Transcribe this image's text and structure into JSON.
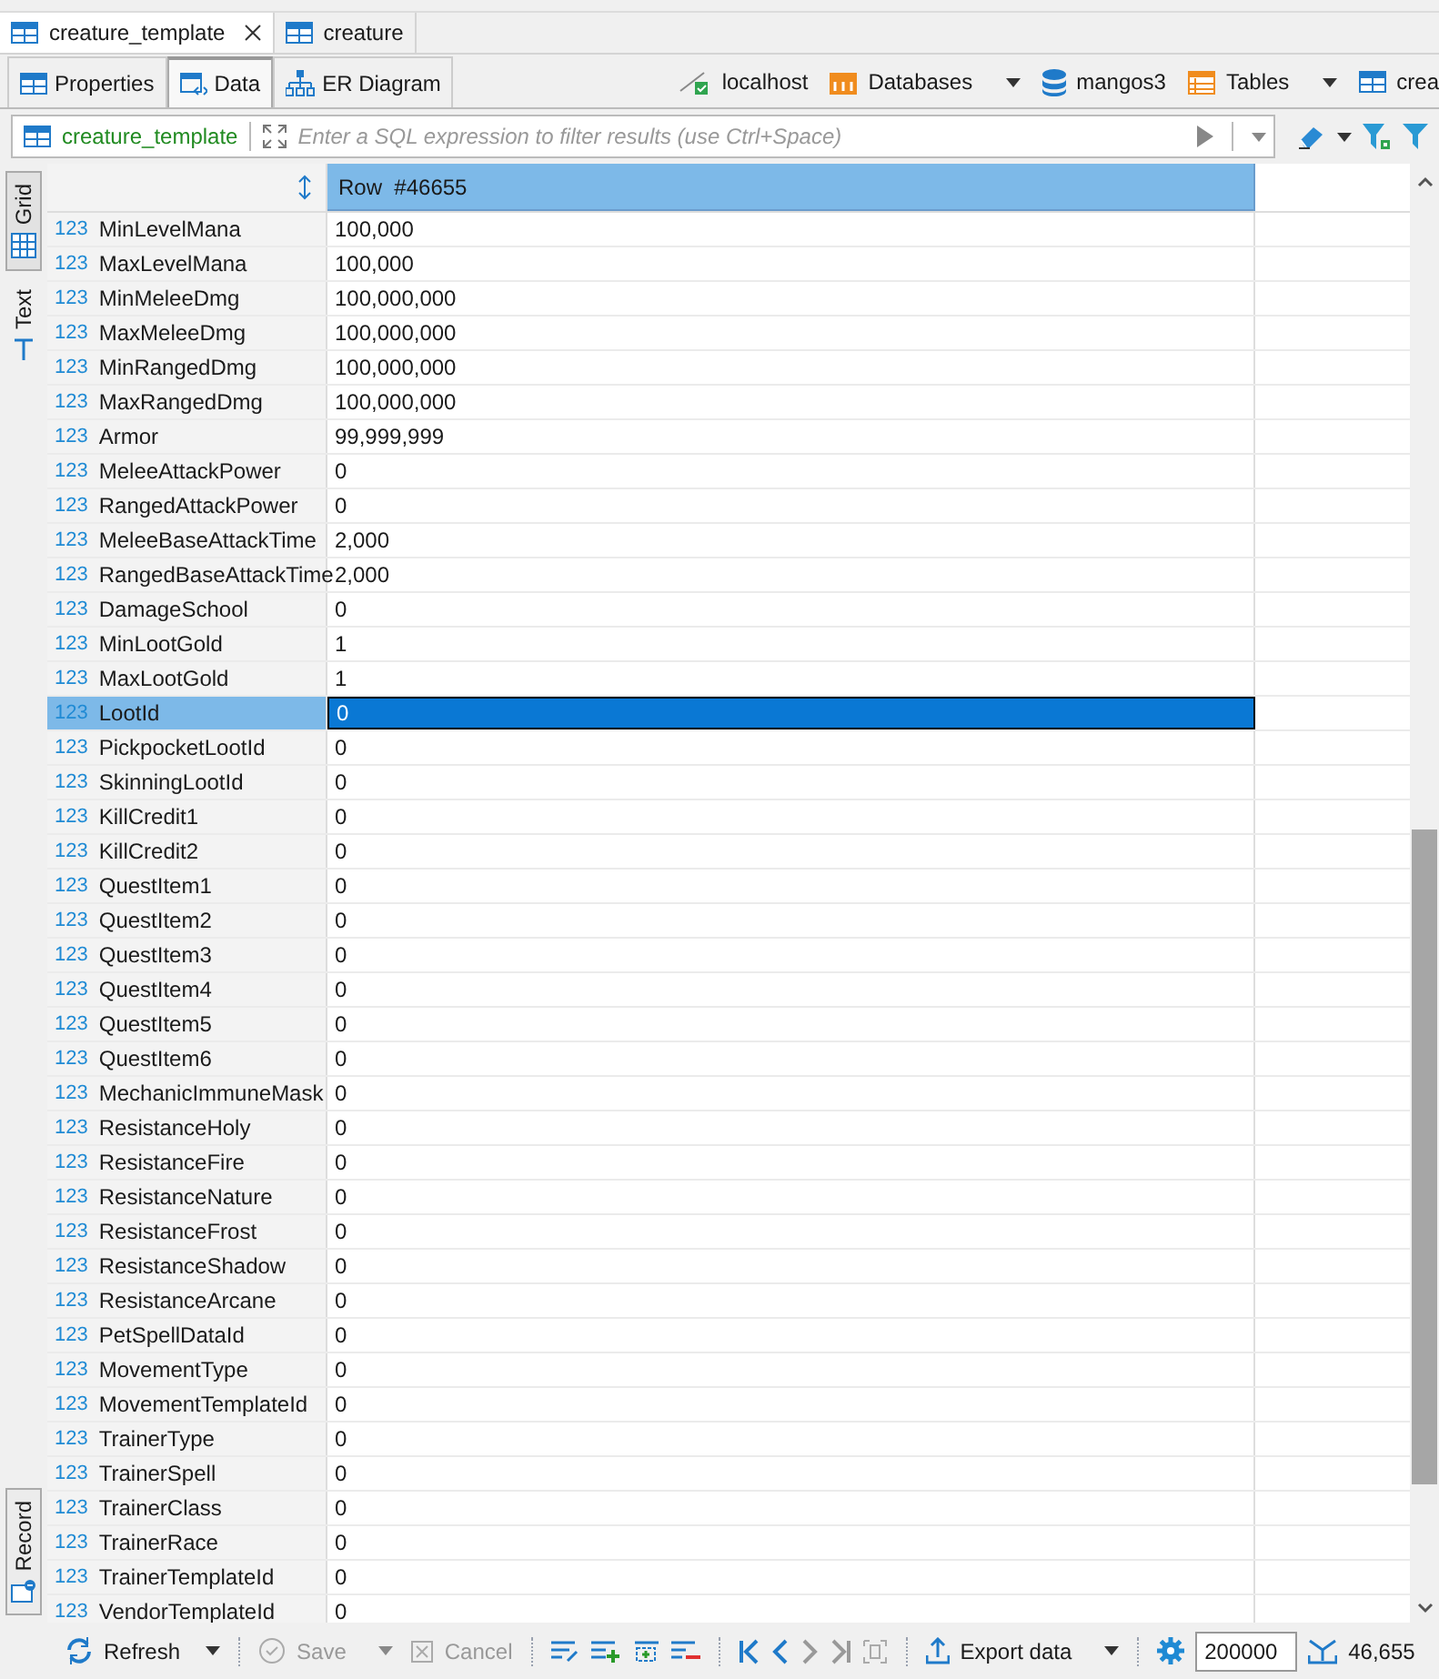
{
  "editor_tabs": [
    {
      "label": "creature_template",
      "selected": true,
      "closable": true
    },
    {
      "label": "creature",
      "selected": false,
      "closable": false
    }
  ],
  "view_tabs": [
    {
      "label": "Properties",
      "selected": false
    },
    {
      "label": "Data",
      "selected": true
    },
    {
      "label": "ER Diagram",
      "selected": false
    }
  ],
  "breadcrumb": [
    {
      "label": "localhost",
      "dropdown": false
    },
    {
      "label": "Databases",
      "dropdown": true
    },
    {
      "label": "mangos3",
      "dropdown": false
    },
    {
      "label": "Tables",
      "dropdown": true
    },
    {
      "label": "crea",
      "dropdown": false
    }
  ],
  "filter": {
    "table": "creature_template",
    "placeholder": "Enter a SQL expression to filter results (use Ctrl+Space)"
  },
  "side_tabs": [
    {
      "label": "Grid",
      "selected": true
    },
    {
      "label": "Text",
      "selected": false
    }
  ],
  "record_tab": {
    "label": "Record"
  },
  "grid": {
    "column_header": "Row  #46655",
    "rows": [
      {
        "type": "123",
        "name": "MinLevelMana",
        "value": "100,000",
        "selected": false
      },
      {
        "type": "123",
        "name": "MaxLevelMana",
        "value": "100,000",
        "selected": false
      },
      {
        "type": "123",
        "name": "MinMeleeDmg",
        "value": "100,000,000",
        "selected": false
      },
      {
        "type": "123",
        "name": "MaxMeleeDmg",
        "value": "100,000,000",
        "selected": false
      },
      {
        "type": "123",
        "name": "MinRangedDmg",
        "value": "100,000,000",
        "selected": false
      },
      {
        "type": "123",
        "name": "MaxRangedDmg",
        "value": "100,000,000",
        "selected": false
      },
      {
        "type": "123",
        "name": "Armor",
        "value": "99,999,999",
        "selected": false
      },
      {
        "type": "123",
        "name": "MeleeAttackPower",
        "value": "0",
        "selected": false
      },
      {
        "type": "123",
        "name": "RangedAttackPower",
        "value": "0",
        "selected": false
      },
      {
        "type": "123",
        "name": "MeleeBaseAttackTime",
        "value": "2,000",
        "selected": false
      },
      {
        "type": "123",
        "name": "RangedBaseAttackTime",
        "value": "2,000",
        "selected": false
      },
      {
        "type": "123",
        "name": "DamageSchool",
        "value": "0",
        "selected": false
      },
      {
        "type": "123",
        "name": "MinLootGold",
        "value": "1",
        "selected": false
      },
      {
        "type": "123",
        "name": "MaxLootGold",
        "value": "1",
        "selected": false
      },
      {
        "type": "123",
        "name": "LootId",
        "value": "0",
        "selected": true
      },
      {
        "type": "123",
        "name": "PickpocketLootId",
        "value": "0",
        "selected": false
      },
      {
        "type": "123",
        "name": "SkinningLootId",
        "value": "0",
        "selected": false
      },
      {
        "type": "123",
        "name": "KillCredit1",
        "value": "0",
        "selected": false
      },
      {
        "type": "123",
        "name": "KillCredit2",
        "value": "0",
        "selected": false
      },
      {
        "type": "123",
        "name": "QuestItem1",
        "value": "0",
        "selected": false
      },
      {
        "type": "123",
        "name": "QuestItem2",
        "value": "0",
        "selected": false
      },
      {
        "type": "123",
        "name": "QuestItem3",
        "value": "0",
        "selected": false
      },
      {
        "type": "123",
        "name": "QuestItem4",
        "value": "0",
        "selected": false
      },
      {
        "type": "123",
        "name": "QuestItem5",
        "value": "0",
        "selected": false
      },
      {
        "type": "123",
        "name": "QuestItem6",
        "value": "0",
        "selected": false
      },
      {
        "type": "123",
        "name": "MechanicImmuneMask",
        "value": "0",
        "selected": false
      },
      {
        "type": "123",
        "name": "ResistanceHoly",
        "value": "0",
        "selected": false
      },
      {
        "type": "123",
        "name": "ResistanceFire",
        "value": "0",
        "selected": false
      },
      {
        "type": "123",
        "name": "ResistanceNature",
        "value": "0",
        "selected": false
      },
      {
        "type": "123",
        "name": "ResistanceFrost",
        "value": "0",
        "selected": false
      },
      {
        "type": "123",
        "name": "ResistanceShadow",
        "value": "0",
        "selected": false
      },
      {
        "type": "123",
        "name": "ResistanceArcane",
        "value": "0",
        "selected": false
      },
      {
        "type": "123",
        "name": "PetSpellDataId",
        "value": "0",
        "selected": false
      },
      {
        "type": "123",
        "name": "MovementType",
        "value": "0",
        "selected": false
      },
      {
        "type": "123",
        "name": "MovementTemplateId",
        "value": "0",
        "selected": false
      },
      {
        "type": "123",
        "name": "TrainerType",
        "value": "0",
        "selected": false
      },
      {
        "type": "123",
        "name": "TrainerSpell",
        "value": "0",
        "selected": false
      },
      {
        "type": "123",
        "name": "TrainerClass",
        "value": "0",
        "selected": false
      },
      {
        "type": "123",
        "name": "TrainerRace",
        "value": "0",
        "selected": false
      },
      {
        "type": "123",
        "name": "TrainerTemplateId",
        "value": "0",
        "selected": false
      },
      {
        "type": "123",
        "name": "VendorTemplateId",
        "value": "0",
        "selected": false
      }
    ]
  },
  "toolbar": {
    "refresh": "Refresh",
    "save": {
      "label": "Save",
      "disabled": true
    },
    "cancel": {
      "label": "Cancel",
      "disabled": true
    },
    "export": "Export data",
    "fetch_size": "200000",
    "row_count": "46,655"
  }
}
